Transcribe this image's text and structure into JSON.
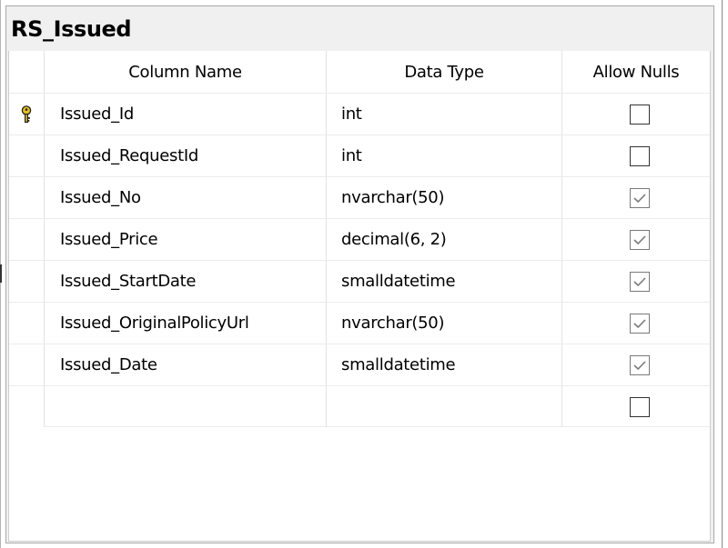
{
  "table": {
    "title": "RS_Issued",
    "columns": {
      "name": "Column Name",
      "type": "Data Type",
      "nulls": "Allow Nulls"
    },
    "rows": [
      {
        "name": "Issued_Id",
        "type": "int",
        "allow_nulls": false,
        "primary_key": true,
        "key_icon": "primary-key-icon"
      },
      {
        "name": "Issued_RequestId",
        "type": "int",
        "allow_nulls": false,
        "primary_key": false
      },
      {
        "name": "Issued_No",
        "type": "nvarchar(50)",
        "allow_nulls": true,
        "primary_key": false
      },
      {
        "name": "Issued_Price",
        "type": "decimal(6, 2)",
        "allow_nulls": true,
        "primary_key": false
      },
      {
        "name": "Issued_StartDate",
        "type": "smalldatetime",
        "allow_nulls": true,
        "primary_key": false
      },
      {
        "name": "Issued_OriginalPolicyUrl",
        "type": "nvarchar(50)",
        "allow_nulls": true,
        "primary_key": false
      },
      {
        "name": "Issued_Date",
        "type": "smalldatetime",
        "allow_nulls": true,
        "primary_key": false
      },
      {
        "name": "",
        "type": "",
        "allow_nulls": false,
        "primary_key": false
      }
    ]
  },
  "colors": {
    "key_gold": "#e8c21a",
    "checkmark": "#7a7a7a",
    "checkbox_border": "#333333"
  }
}
